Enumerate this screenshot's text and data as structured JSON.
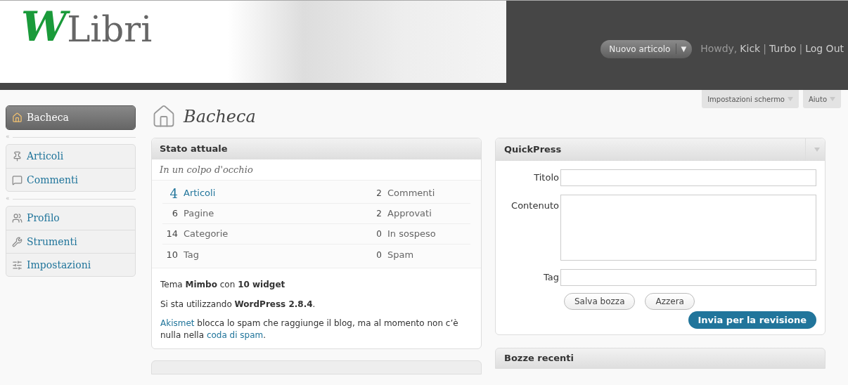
{
  "header": {
    "logo_mark": "W",
    "logo_text": "Libri",
    "new_button": "Nuovo articolo",
    "new_caret": "▼",
    "howdy": "Howdy,",
    "user_links": [
      {
        "text": "Kick",
        "kind": "link"
      },
      {
        "text": "|",
        "kind": "separator"
      },
      {
        "text": "Turbo",
        "kind": "link"
      },
      {
        "text": "|",
        "kind": "separator"
      },
      {
        "text": "Log Out",
        "kind": "link"
      }
    ]
  },
  "screen_tabs": [
    {
      "label": "Impostazioni schermo"
    },
    {
      "label": "Aiuto"
    }
  ],
  "sidebar": {
    "groups": [
      [
        {
          "label": "Bacheca",
          "selected": true
        }
      ],
      [
        {
          "label": "Articoli",
          "selected": false
        },
        {
          "label": "Commenti",
          "selected": false
        }
      ],
      [
        {
          "label": "Profilo",
          "selected": false
        },
        {
          "label": "Strumenti",
          "selected": false
        },
        {
          "label": "Impostazioni",
          "selected": false
        }
      ]
    ],
    "collapse": "«"
  },
  "page_title": "Bacheca",
  "stato": {
    "title": "Stato attuale",
    "subtitle": "In un colpo d'occhio",
    "rows": [
      {
        "left": {
          "count": "4",
          "label": "Articoli",
          "kind": "link"
        },
        "right": {
          "count": "2",
          "label": "Commenti"
        }
      },
      {
        "left": {
          "count": "6",
          "label": "Pagine",
          "kind": "plain"
        },
        "right": {
          "count": "2",
          "label": "Approvati"
        }
      },
      {
        "left": {
          "count": "14",
          "label": "Categorie",
          "kind": "plain"
        },
        "right": {
          "count": "0",
          "label": "In sospeso"
        }
      },
      {
        "left": {
          "count": "10",
          "label": "Tag",
          "kind": "plain"
        },
        "right": {
          "count": "0",
          "label": "Spam"
        }
      }
    ],
    "theme_line": "Tema **Mimbo** con **10 widget**",
    "version_line": "Si sta utilizzando **WordPress 2.8.4**.",
    "akismet": [
      {
        "text": "Akismet",
        "kind": "link"
      },
      {
        "text": " blocca lo spam che raggiunge il blog, ma al momento non c’è nulla nella ",
        "kind": "text"
      },
      {
        "text": "coda di spam",
        "kind": "link"
      },
      {
        "text": ".",
        "kind": "text"
      }
    ]
  },
  "quickpress": {
    "title": "QuickPress",
    "fields": [
      {
        "label": "Titolo",
        "kind": "line"
      },
      {
        "label": "Contenuto",
        "kind": "area"
      },
      {
        "label": "Tag",
        "kind": "line"
      }
    ],
    "buttons": [
      "Salva bozza",
      "Azzera"
    ],
    "submit": "Invia per la revisione"
  },
  "bozze": {
    "title": "Bozze recenti"
  }
}
